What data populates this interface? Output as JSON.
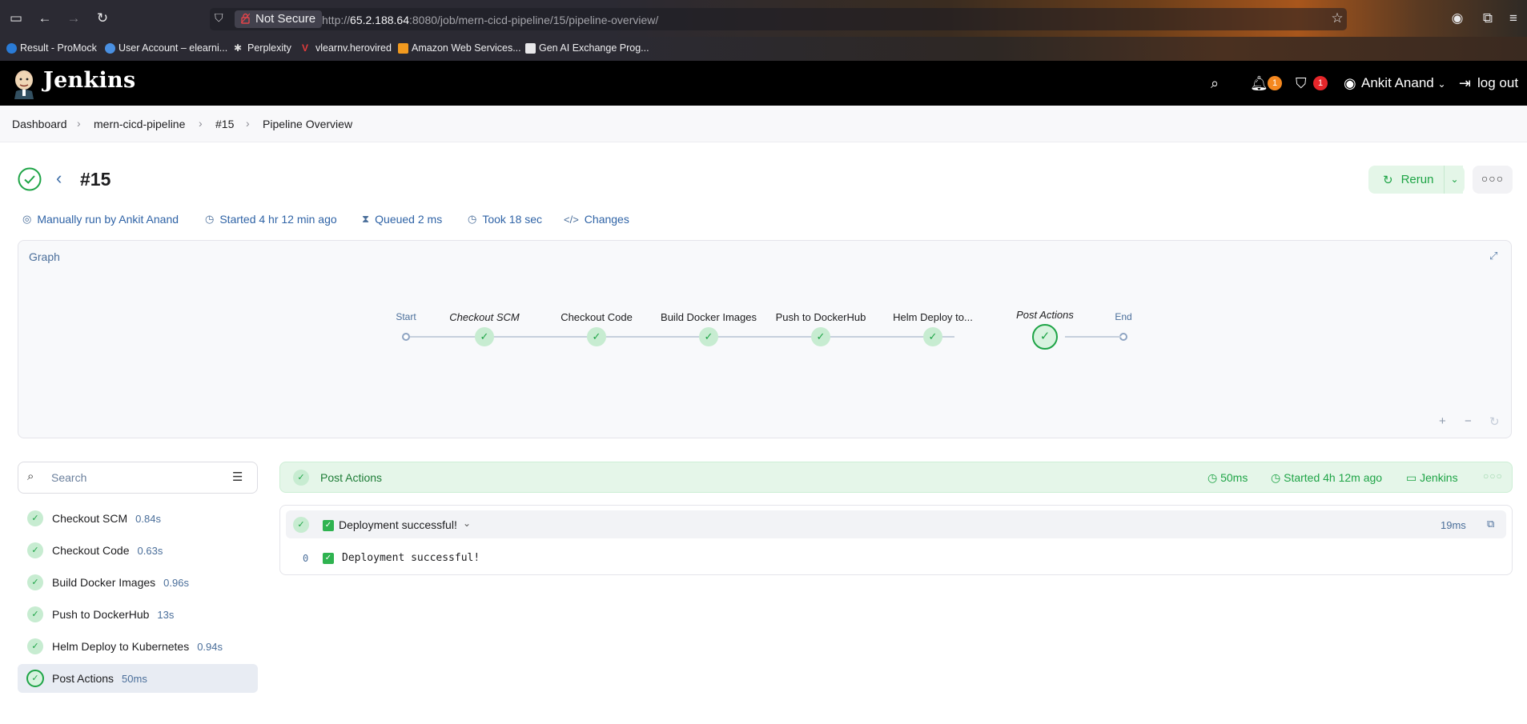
{
  "browser": {
    "not_secure": "Not Secure",
    "url_host": "65.2.188.64",
    "url_prefix": "http://",
    "url_rest": ":8080/job/mern-cicd-pipeline/15/pipeline-overview/",
    "bookmarks": [
      "Result - ProMock",
      "User Account – elearni...",
      "Perplexity",
      "vlearnv.herovired",
      "Amazon Web Services...",
      "Gen AI Exchange Prog..."
    ]
  },
  "header": {
    "brand": "Jenkins",
    "notification_count": "1",
    "security_count": "1",
    "user": "Ankit Anand",
    "logout": "log out"
  },
  "breadcrumb": [
    "Dashboard",
    "mern-cicd-pipeline",
    "#15",
    "Pipeline Overview"
  ],
  "run": {
    "title": "#15",
    "rerun": "Rerun",
    "meta": {
      "trigger": "Manually run by Ankit Anand",
      "started": "Started 4 hr 12 min ago",
      "queued": "Queued 2 ms",
      "took": "Took 18 sec",
      "changes": "Changes"
    }
  },
  "graph": {
    "label": "Graph",
    "start": "Start",
    "end": "End",
    "stages": [
      "Checkout SCM",
      "Checkout Code",
      "Build Docker Images",
      "Push to DockerHub",
      "Helm Deploy to...",
      "Post Actions"
    ]
  },
  "sidebar": {
    "search_placeholder": "Search",
    "stages": [
      {
        "name": "Checkout SCM",
        "duration": "0.84s"
      },
      {
        "name": "Checkout Code",
        "duration": "0.63s"
      },
      {
        "name": "Build Docker Images",
        "duration": "0.96s"
      },
      {
        "name": "Push to DockerHub",
        "duration": "13s"
      },
      {
        "name": "Helm Deploy to Kubernetes",
        "duration": "0.94s"
      },
      {
        "name": "Post Actions",
        "duration": "50ms"
      }
    ]
  },
  "detail": {
    "stage": "Post Actions",
    "duration": "50ms",
    "started": "Started 4h 12m ago",
    "agent": "Jenkins",
    "step_title": "Deployment successful!",
    "step_duration": "19ms",
    "log_line_number": "0",
    "log_line": "Deployment successful!"
  },
  "colors": {
    "success": "#1ea446",
    "link": "#2f63a6",
    "header_bg": "#000000"
  }
}
